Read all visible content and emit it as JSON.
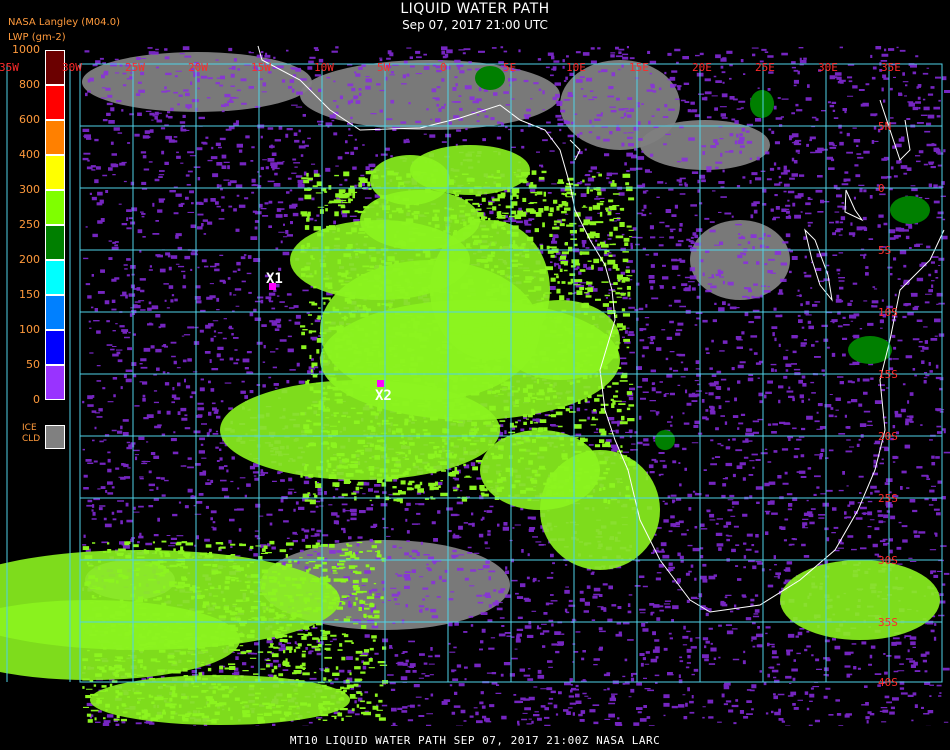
{
  "header": {
    "title": "LIQUID WATER PATH",
    "subtitle": "Sep 07, 2017 21:00 UTC"
  },
  "source": "NASA Langley (M04.0)",
  "units": "LWP (gm-2)",
  "legend": {
    "ticks": [
      "1000",
      "800",
      "600",
      "400",
      "300",
      "250",
      "200",
      "150",
      "100",
      "50",
      "0"
    ],
    "bins": [
      {
        "from": 800,
        "to": 1000,
        "color": "#6b0000"
      },
      {
        "from": 600,
        "to": 800,
        "color": "#ff0000"
      },
      {
        "from": 400,
        "to": 600,
        "color": "#ff8000"
      },
      {
        "from": 300,
        "to": 400,
        "color": "#ffff00"
      },
      {
        "from": 250,
        "to": 300,
        "color": "#7fff00"
      },
      {
        "from": 200,
        "to": 250,
        "color": "#007f00"
      },
      {
        "from": 150,
        "to": 200,
        "color": "#00ffff"
      },
      {
        "from": 100,
        "to": 150,
        "color": "#0080ff"
      },
      {
        "from": 50,
        "to": 100,
        "color": "#0000ff"
      },
      {
        "from": 0,
        "to": 50,
        "color": "#9933ff"
      }
    ],
    "ice_label_1": "ICE",
    "ice_label_2": "CLD",
    "ice_color": "#808080"
  },
  "lon_labels": [
    "35W",
    "30W",
    "25W",
    "20W",
    "15W",
    "10W",
    "5W",
    "0",
    "5E",
    "10E",
    "15E",
    "20E",
    "25E",
    "30E",
    "35E"
  ],
  "lat_labels": [
    "5N",
    "0",
    "5S",
    "10S",
    "15S",
    "20S",
    "25S",
    "30S",
    "35S",
    "40S"
  ],
  "markers": [
    {
      "id": "X1",
      "lon": -20.5,
      "lat": -6.5
    },
    {
      "id": "X2",
      "lon": -11,
      "lat": -15.5
    }
  ],
  "footer": "MT10  LIQUID WATER PATH   SEP 07, 2017 21:00Z   NASA LARC",
  "colors": {
    "grid": "#4fd2e8",
    "coast": "#ffffff",
    "label": "#ff2a2a",
    "cloud_green": "#8cf41f",
    "cloud_purple": "#8a2be2",
    "ice": "#808080",
    "land": "#000000"
  }
}
